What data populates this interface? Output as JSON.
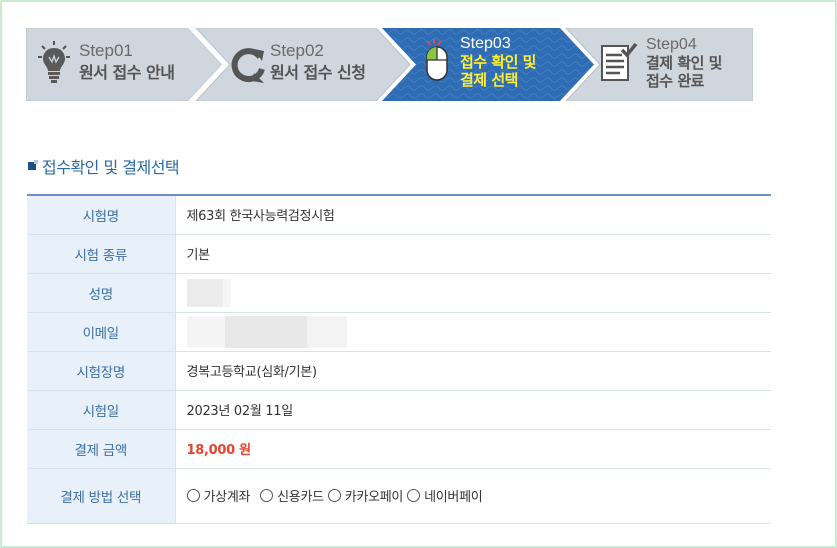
{
  "steps": [
    {
      "num": "Step01",
      "label_line1": "원서 접수 안내",
      "label_line2": "",
      "icon": "lightbulb-icon",
      "active": false
    },
    {
      "num": "Step02",
      "label_line1": "원서 접수 신청",
      "label_line2": "",
      "icon": "refresh-icon",
      "active": false
    },
    {
      "num": "Step03",
      "label_line1": "접수 확인 및",
      "label_line2": "결제 선택",
      "icon": "mouse-icon",
      "active": true
    },
    {
      "num": "Step04",
      "label_line1": "결제 확인 및",
      "label_line2": "접수 완료",
      "icon": "checklist-icon",
      "active": false
    }
  ],
  "section_title": "접수확인 및 결제선택",
  "rows": {
    "exam_name": {
      "label": "시험명",
      "value": "제63회 한국사능력검정시험"
    },
    "exam_type": {
      "label": "시험 종류",
      "value": "기본"
    },
    "name": {
      "label": "성명",
      "value": ""
    },
    "email": {
      "label": "이메일",
      "value": ""
    },
    "venue": {
      "label": "시험장명",
      "value": "경복고등학교(심화/기본)"
    },
    "exam_date": {
      "label": "시험일",
      "value": "2023년 02월 11일"
    },
    "amount": {
      "label": "결제 금액",
      "value": "18,000 원"
    },
    "payment": {
      "label": "결제 방법 선택",
      "options": [
        "가상계좌",
        "신용카드",
        "카카오페이",
        "네이버페이"
      ]
    }
  },
  "colors": {
    "active_step": "#2e6db4",
    "inactive_step": "#cfd6dd",
    "accent_text": "#2b6aa6",
    "amount": "#e3452e",
    "highlight": "#ffee33"
  }
}
